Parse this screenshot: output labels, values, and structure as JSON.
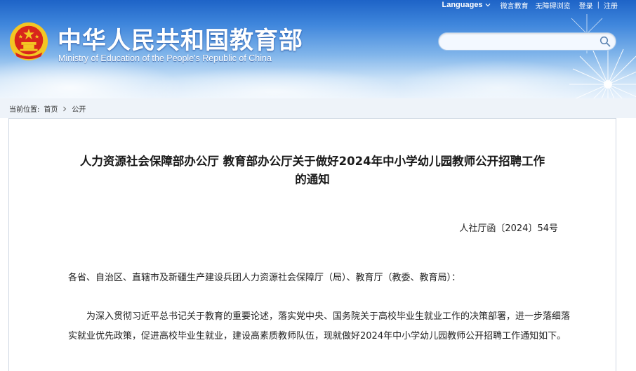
{
  "topbar": {
    "languages": "Languages",
    "link1": "微言教育",
    "link2": "无障碍浏览",
    "login": "登录",
    "separator": "|",
    "register": "注册"
  },
  "header": {
    "title_cn": "中华人民共和国教育部",
    "title_en": "Ministry of Education of the People's Republic of China"
  },
  "search": {
    "value": "",
    "placeholder": ""
  },
  "breadcrumb": {
    "label": "当前位置:",
    "home": "首页",
    "current": "公开"
  },
  "article": {
    "title_line1": "人力资源社会保障部办公厅 教育部办公厅关于做好2024年中小学幼儿园教师公开招聘工作",
    "title_line2": "的通知",
    "doc_number": "人社厅函〔2024〕54号",
    "salutation": "各省、自治区、直辖市及新疆生产建设兵团人力资源社会保障厅（局）、教育厅（教委、教育局）：",
    "paragraph1": "为深入贯彻习近平总书记关于教育的重要论述，落实党中央、国务院关于高校毕业生就业工作的决策部署，进一步落细落实就业优先政策，促进高校毕业生就业，建设高素质教师队伍，现就做好2024年中小学幼儿园教师公开招聘工作通知如下。"
  },
  "icons": {
    "emblem": "national-emblem-icon",
    "search": "search-icon",
    "chevron": "chevron-down-icon"
  },
  "colors": {
    "header_blue": "#1e63c7",
    "emblem_red": "#d8261c",
    "emblem_gold": "#f3c623"
  }
}
